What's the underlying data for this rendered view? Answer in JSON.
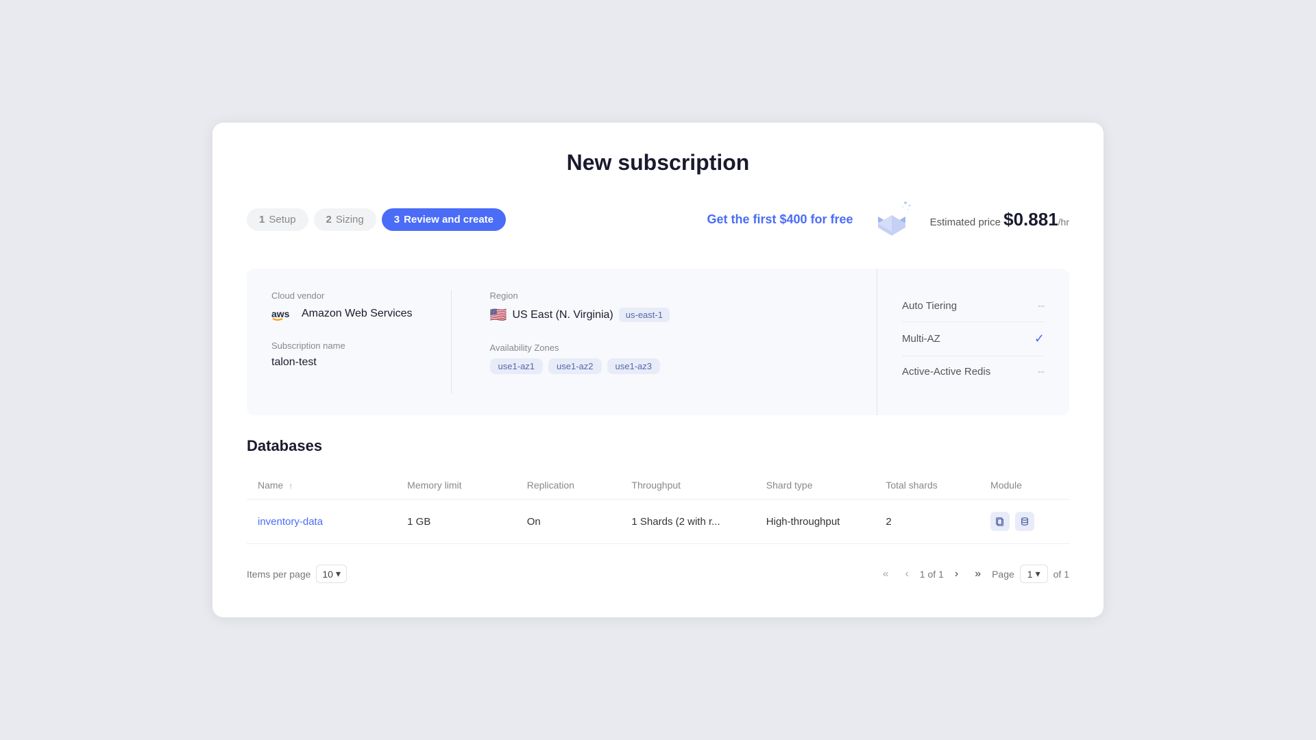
{
  "page": {
    "title": "New subscription"
  },
  "steps": [
    {
      "number": "1",
      "label": "Setup",
      "active": false
    },
    {
      "number": "2",
      "label": "Sizing",
      "active": false
    },
    {
      "number": "3",
      "label": "Review and create",
      "active": true
    }
  ],
  "pricing": {
    "free_offer_prefix": "Get the first ",
    "free_amount": "$400",
    "free_offer_suffix": " for free",
    "estimated_label": "Estimated price",
    "estimated_value": "$0.881",
    "per_hr": "/hr"
  },
  "subscription": {
    "cloud_vendor_label": "Cloud vendor",
    "cloud_vendor_value": "Amazon Web Services",
    "region_label": "Region",
    "region_value": "US East (N. Virginia)",
    "region_code": "us-east-1",
    "subscription_name_label": "Subscription name",
    "subscription_name_value": "talon-test",
    "availability_zones_label": "Availability Zones",
    "availability_zones": [
      "use1-az1",
      "use1-az2",
      "use1-az3"
    ]
  },
  "features": {
    "auto_tiering_label": "Auto Tiering",
    "auto_tiering_value": "--",
    "multi_az_label": "Multi-AZ",
    "multi_az_value": "check",
    "active_active_label": "Active-Active Redis",
    "active_active_value": "--"
  },
  "databases": {
    "section_title": "Databases",
    "columns": {
      "name": "Name",
      "memory_limit": "Memory limit",
      "replication": "Replication",
      "throughput": "Throughput",
      "shard_type": "Shard type",
      "total_shards": "Total shards",
      "module": "Module"
    },
    "rows": [
      {
        "name": "inventory-data",
        "memory_limit": "1 GB",
        "replication": "On",
        "throughput": "1 Shards (2 with r...",
        "shard_type": "High-throughput",
        "total_shards": "2",
        "modules": [
          "copy",
          "database"
        ]
      }
    ]
  },
  "pagination": {
    "items_per_page_label": "Items per page",
    "items_per_page_value": "10",
    "current_page": "1",
    "total_pages": "1",
    "page_label": "Page",
    "of_label": "of"
  }
}
